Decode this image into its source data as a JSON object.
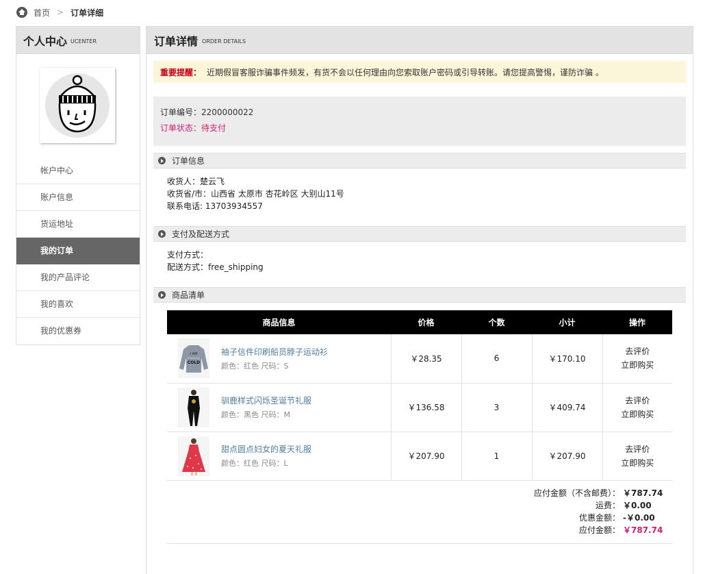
{
  "breadcrumb": {
    "home": "首页",
    "separator": ">",
    "current": "订单详细"
  },
  "sidebar": {
    "title": "个人中心",
    "subtitle": "UCENTER",
    "items": [
      {
        "label": "帐户中心"
      },
      {
        "label": "账户信息"
      },
      {
        "label": "货运地址"
      },
      {
        "label": "我的订单",
        "active": true
      },
      {
        "label": "我的产品评论"
      },
      {
        "label": "我的喜欢"
      },
      {
        "label": "我的优惠券"
      }
    ]
  },
  "main": {
    "title": "订单详情",
    "subtitle": "ORDER DETAILS",
    "notice_label": "重要提醒：",
    "notice_text": "近期假冒客服诈骗事件频发，有货不会以任何理由向您索取账户密码或引导转账。请您提高警惕，谨防诈骗 。",
    "order_no_label": "订单编号：",
    "order_no": "2200000022",
    "status_label": "订单状态：",
    "status": "待支付"
  },
  "order_info": {
    "title": "订单信息",
    "consignee": "收货人：楚云飞",
    "address": "收货省/市：山西省 太原市 杏花岭区 大别山11号",
    "phone": "联系电话: 13703934557"
  },
  "payment": {
    "title": "支付及配送方式",
    "pay_method": "支付方式：",
    "ship_method": "配送方式：free_shipping"
  },
  "goods": {
    "title": "商品清单",
    "headers": {
      "info": "商品信息",
      "price": "价格",
      "qty": "个数",
      "subtotal": "小计",
      "ops": "操作"
    },
    "rows": [
      {
        "name": "袖子信件印刷船员脖子运动衫",
        "meta": "颜色：红色 尺码：S",
        "price": "￥28.35",
        "qty": "6",
        "subtotal": "￥170.10",
        "op1": "去评价",
        "op2": "立即购买",
        "thumb_text_1": "I AM",
        "thumb_text_2": "Freezing",
        "thumb_text_3": "COLD"
      },
      {
        "name": "驯鹿样式闪烁圣诞节礼服",
        "meta": "颜色：黑色 尺码：M",
        "price": "￥136.58",
        "qty": "3",
        "subtotal": "￥409.74",
        "op1": "去评价",
        "op2": "立即购买"
      },
      {
        "name": "甜点圆点妇女的夏天礼服",
        "meta": "颜色：红色 尺码：L",
        "price": "￥207.90",
        "qty": "1",
        "subtotal": "￥207.90",
        "op1": "去评价",
        "op2": "立即购买"
      }
    ]
  },
  "totals": {
    "goods_label": "应付金额（不含邮费）：",
    "goods_value": "￥787.74",
    "shipping_label": "运费：",
    "shipping_value": "￥0.00",
    "discount_label": "优惠金额：",
    "discount_value": "-￥0.00",
    "payable_label": "应付金额：",
    "payable_value": "￥787.74"
  },
  "colors": {
    "accent": "#d41e6c",
    "link": "#4e7fa0",
    "notice_bg": "#fbf6d9",
    "active_menu": "#666666"
  }
}
